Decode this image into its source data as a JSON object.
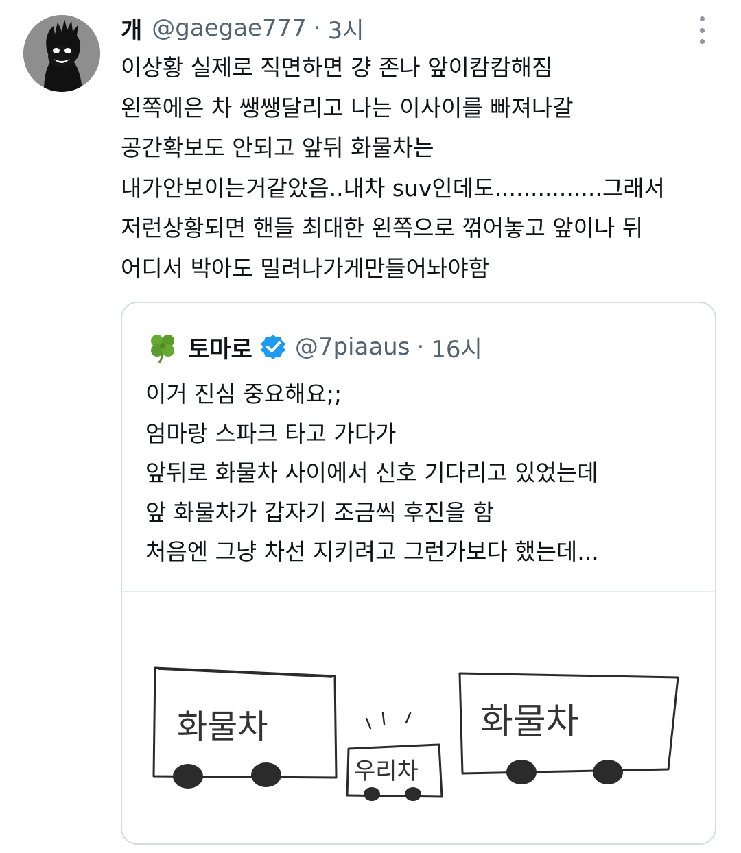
{
  "tweet": {
    "author_name": "개",
    "handle": "@gaegae777",
    "separator": "·",
    "time": "3시",
    "lines": [
      "이상황 실제로 직면하면 걍 존나 앞이캄캄해짐",
      "왼쪽에은 차 쌩쌩달리고 나는 이사이를 빠져나갈",
      "공간확보도 안되고 앞뒤 화물차는",
      "내가안보이는거같았음..내차 suv인데도...............그래서",
      "저런상황되면 핸들 최대한 왼쪽으로 꺾어놓고 앞이나 뒤",
      "어디서 박아도 밀려나가게만들어놔야함"
    ]
  },
  "quoted_tweet": {
    "author_name": "토마로",
    "handle": "@7piaaus",
    "separator": "·",
    "time": "16시",
    "lines": [
      "이거 진심 중요해요;;",
      "엄마랑 스파크 타고 가다가",
      "앞뒤로 화물차 사이에서 신호 기다리고 있었는데",
      "앞 화물차가 갑자기 조금씩 후진을 함",
      "처음엔 그냥 차선 지키려고 그런가보다 했는데..."
    ],
    "drawing": {
      "left_truck_label": "화물차",
      "middle_car_label": "우리차",
      "right_truck_label": "화물차"
    }
  },
  "icons": {
    "more": "more-vertical-icon",
    "verified": "verified-badge-icon",
    "clover": "four-leaf-clover-icon"
  },
  "colors": {
    "text": "#0f1419",
    "secondary": "#536471",
    "verified_blue": "#1d9bf0",
    "border": "#d5dde3"
  }
}
